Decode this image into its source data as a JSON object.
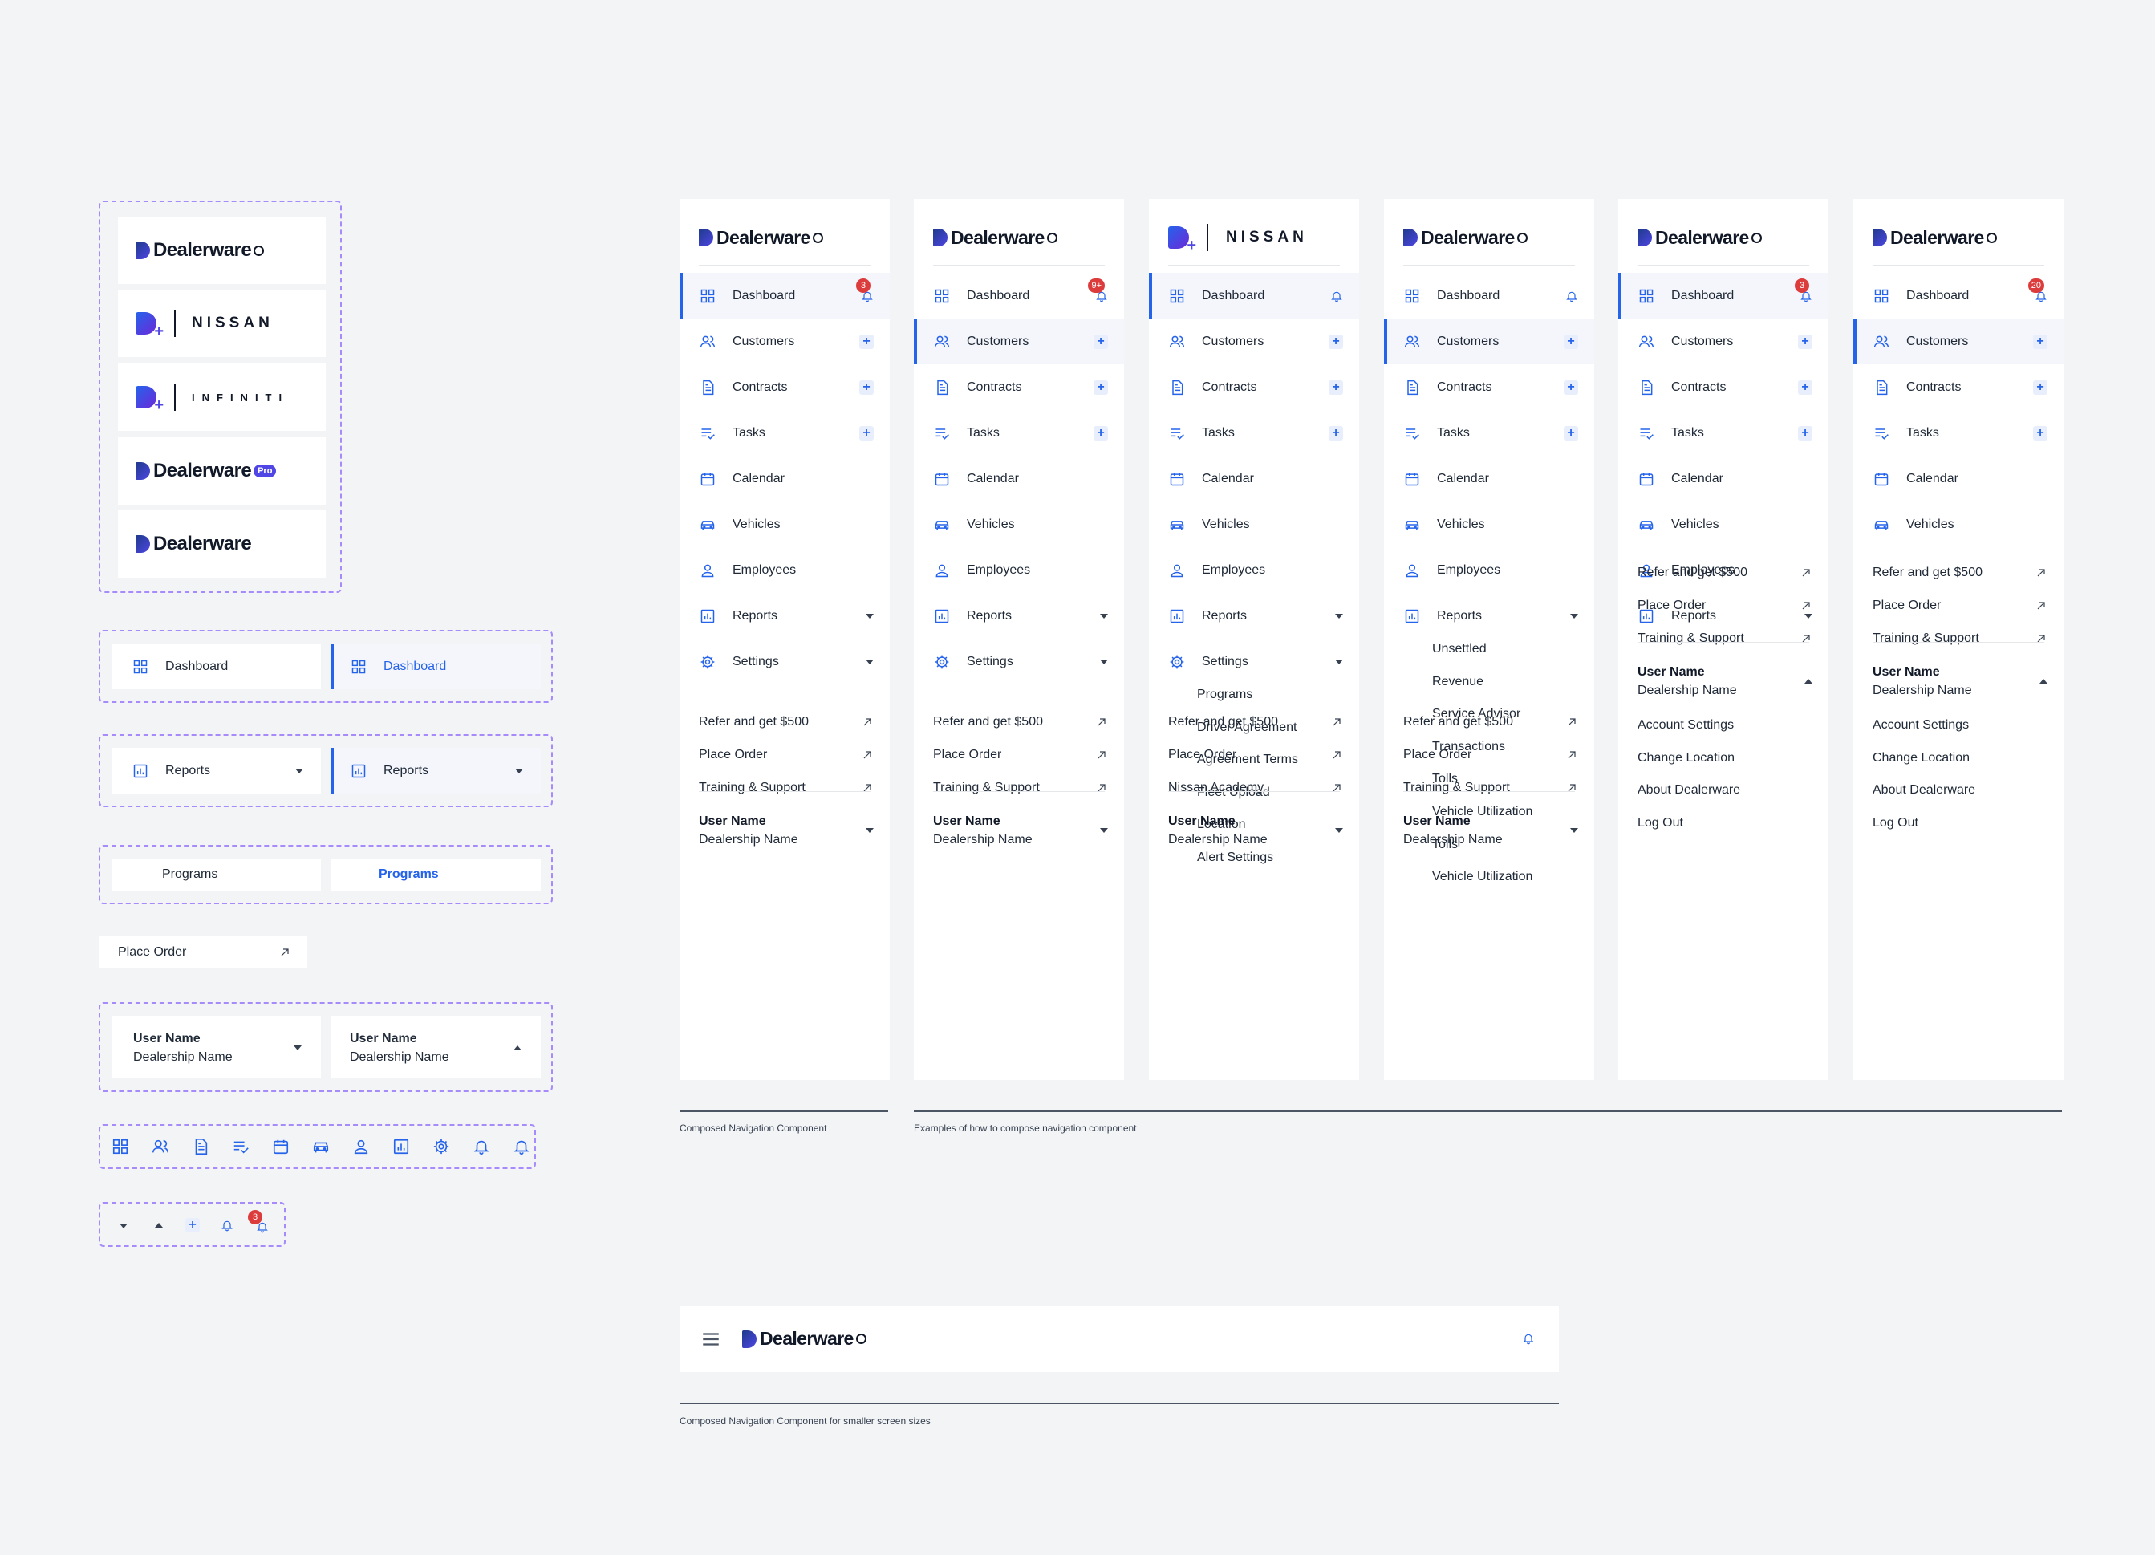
{
  "brand": {
    "name": "Dealerware",
    "pro_badge": "Pro",
    "partners": [
      "NISSAN",
      "INFINITI"
    ],
    "accent": "#2563eb",
    "badge_color": "#dc3c3c",
    "dash_color": "#a78bfa"
  },
  "components": {
    "dashboard": "Dashboard",
    "reports": "Reports",
    "programs": "Programs",
    "place_order": "Place Order",
    "user_name": "User Name",
    "dealership": "Dealership Name",
    "icon_row": [
      "dashboard-icon",
      "customers-icon",
      "contracts-icon",
      "tasks-icon",
      "calendar-icon",
      "vehicles-icon",
      "employees-icon",
      "reports-icon",
      "settings-icon",
      "bell-icon",
      "bell-ring-icon"
    ],
    "controls": [
      "chevron-down-icon",
      "chevron-up-icon",
      "plus-icon",
      "bell-icon",
      "bell-badge-icon"
    ],
    "badge_count": "3"
  },
  "nav": {
    "dashboard": "Dashboard",
    "customers": "Customers",
    "contracts": "Contracts",
    "tasks": "Tasks",
    "calendar": "Calendar",
    "vehicles": "Vehicles",
    "employees": "Employees",
    "reports": "Reports",
    "settings": "Settings"
  },
  "settings_sub": [
    "Programs",
    "Driver Agreement",
    "Agreement Terms",
    "Fleet Upload",
    "Location",
    "Alert Settings"
  ],
  "reports_sub": [
    "Unsettled",
    "Revenue",
    "Service Advisor",
    "Transactions",
    "Tolls",
    "Vehicle Utilization",
    "Tolls",
    "Vehicle Utilization"
  ],
  "links": {
    "refer": "Refer and get $500",
    "place_order": "Place Order",
    "training": "Training & Support",
    "academy": "Nissan Academy"
  },
  "user_menu": [
    "Account Settings",
    "Change Location",
    "About Dealerware",
    "Log Out"
  ],
  "badges": {
    "p1": "3",
    "p2": "9+",
    "p5": "3",
    "p6": "20"
  },
  "captions": {
    "composed": "Composed Navigation Component",
    "examples": "Examples of how to compose navigation component",
    "small": "Composed Navigation Component for smaller screen sizes"
  }
}
